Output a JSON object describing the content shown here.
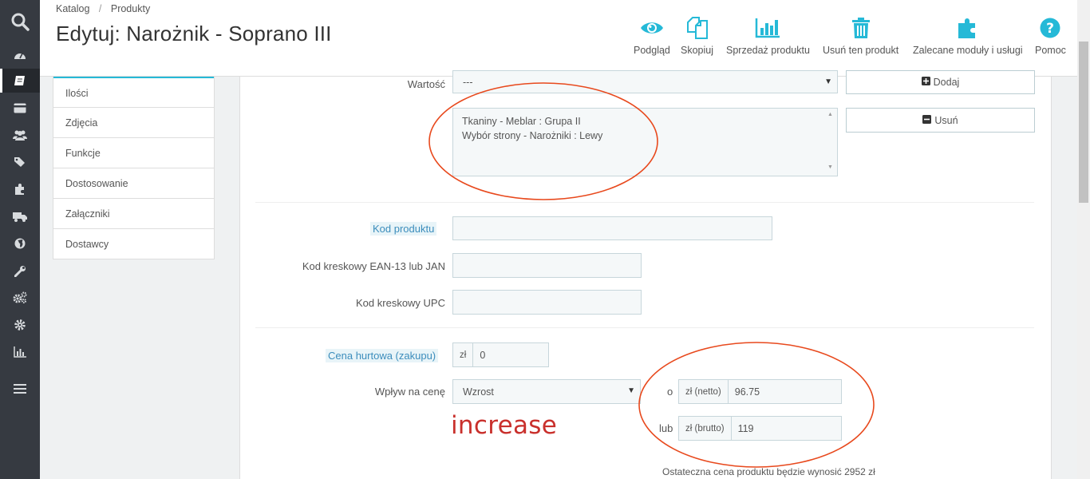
{
  "nav_icons": [
    "search-icon",
    "dashboard-icon",
    "catalog-icon",
    "orders-icon",
    "customers-icon",
    "tags-icon",
    "modules-icon",
    "shipping-icon",
    "localization-icon",
    "preferences-icon",
    "advanced-params-icon",
    "settings-icon",
    "stats-icon",
    "menu-icon"
  ],
  "breadcrumb": {
    "item1": "Katalog",
    "separator": "/",
    "item2": "Produkty"
  },
  "page_title": "Edytuj: Narożnik - Soprano III",
  "toolbar": {
    "preview": "Podgląd",
    "duplicate": "Skopiuj",
    "sales": "Sprzedaż produktu",
    "delete": "Usuń ten produkt",
    "modules": "Zalecane moduły i usługi",
    "help": "Pomoc"
  },
  "tabs": [
    "Ilości",
    "Zdjęcia",
    "Funkcje",
    "Dostosowanie",
    "Załączniki",
    "Dostawcy"
  ],
  "form": {
    "value_label": "Wartość",
    "value_select": "---",
    "add_button": "Dodaj",
    "remove_button": "Usuń",
    "combination_items": [
      "Tkaniny - Meblar : Grupa II",
      "Wybór strony - Narożniki : Lewy"
    ],
    "product_code_label": "Kod produktu",
    "ean_label": "Kod kreskowy EAN-13 lub JAN",
    "upc_label": "Kod kreskowy UPC",
    "wholesale_label": "Cena hurtowa (zakupu)",
    "wholesale_currency": "zł",
    "wholesale_value": "0",
    "impact_label": "Wpływ na cenę",
    "impact_select": "Wzrost",
    "or_text": "o",
    "lub_text": "lub",
    "net_addon": "zł (netto)",
    "net_value": "96.75",
    "gross_addon": "zł (brutto)",
    "gross_value": "119",
    "final_price_text": "Ostateczna cena produktu będzie wynosić 2952 zł"
  },
  "annotation": {
    "text": "increase",
    "color": "#c9302c",
    "circle_color": "#e8491d"
  },
  "colors": {
    "accent": "#25b9d7",
    "icon_blue": "#25b9d7",
    "nav_bg": "#363a41"
  }
}
